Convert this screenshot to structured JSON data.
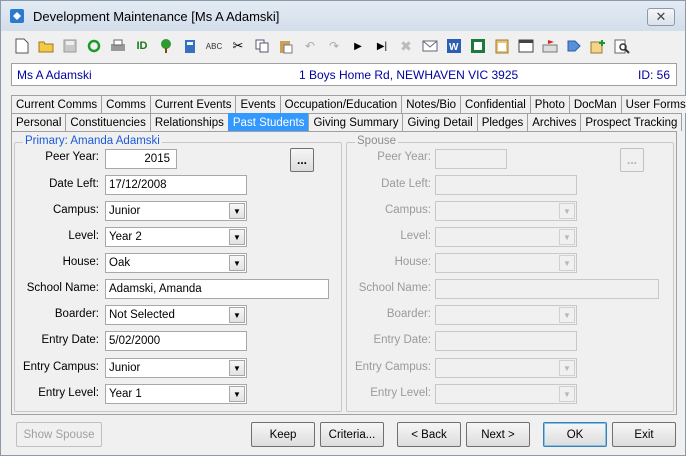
{
  "window": {
    "title": "Development Maintenance  [Ms A Adamski]",
    "close_glyph": "✕"
  },
  "toolbar": {
    "icons": [
      "new-icon",
      "open-folder-icon",
      "save-icon",
      "refresh-icon",
      "print-icon",
      "id-icon",
      "tree-icon",
      "calculator-icon",
      "spellcheck-icon",
      "cut-icon",
      "copy-icon",
      "paste-icon",
      "undo-icon",
      "redo-icon",
      "play-icon",
      "skip-icon",
      "delete-icon",
      "email-icon",
      "word-icon",
      "excel-icon",
      "clipboard-icon",
      "calendar-icon",
      "flag-icon",
      "tag-icon",
      "note-add-icon",
      "preview-icon"
    ]
  },
  "info": {
    "name": "Ms A Adamski",
    "address": "1 Boys Home Rd, NEWHAVEN VIC 3925",
    "id": "ID: 56"
  },
  "tabs_row1": [
    "Current Comms",
    "Comms",
    "Current Events",
    "Events",
    "Occupation/Education",
    "Notes/Bio",
    "Confidential",
    "Photo",
    "DocMan",
    "User Forms"
  ],
  "tabs_row2": [
    "Personal",
    "Constituencies",
    "Relationships",
    "Past Students",
    "Giving Summary",
    "Giving Detail",
    "Pledges",
    "Archives",
    "Prospect Tracking"
  ],
  "active_tab": "Past Students",
  "primary": {
    "title": "Primary: Amanda Adamski",
    "ellipsis": "...",
    "labels": {
      "peer_year": "Peer Year:",
      "date_left": "Date Left:",
      "campus": "Campus:",
      "level": "Level:",
      "house": "House:",
      "school_name": "School Name:",
      "boarder": "Boarder:",
      "entry_date": "Entry Date:",
      "entry_campus": "Entry Campus:",
      "entry_level": "Entry Level:"
    },
    "values": {
      "peer_year": "2015",
      "date_left": "17/12/2008",
      "campus": "Junior",
      "level": "Year 2",
      "house": "Oak",
      "school_name": "Adamski, Amanda",
      "boarder": "Not Selected",
      "entry_date": "5/02/2000",
      "entry_campus": "Junior",
      "entry_level": "Year 1"
    }
  },
  "spouse": {
    "title": "Spouse",
    "ellipsis": "...",
    "labels": {
      "peer_year": "Peer Year:",
      "date_left": "Date Left:",
      "campus": "Campus:",
      "level": "Level:",
      "house": "House:",
      "school_name": "School Name:",
      "boarder": "Boarder:",
      "entry_date": "Entry Date:",
      "entry_campus": "Entry Campus:",
      "entry_level": "Entry Level:"
    }
  },
  "buttons": {
    "show_spouse": "Show Spouse",
    "keep": "Keep",
    "criteria": "Criteria...",
    "back": "< Back",
    "next": "Next >",
    "ok": "OK",
    "exit": "Exit"
  }
}
